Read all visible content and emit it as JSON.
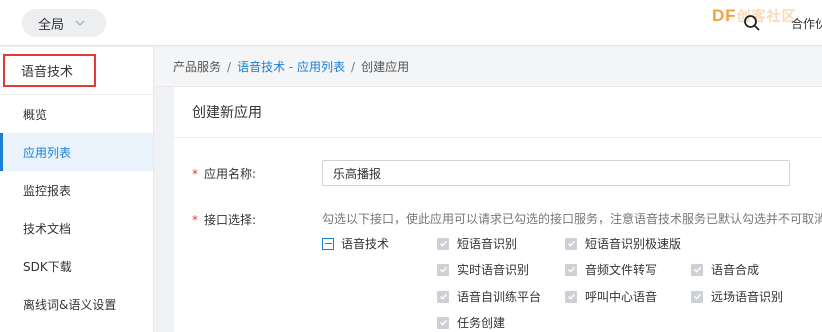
{
  "topbar": {
    "region": "全局",
    "logo_main": "DF",
    "logo_tail": "创客社区",
    "coop": "合作伙"
  },
  "sidebar": {
    "title": "语音技术",
    "items": [
      {
        "label": "概览",
        "active": false
      },
      {
        "label": "应用列表",
        "active": true
      },
      {
        "label": "监控报表",
        "active": false
      },
      {
        "label": "技术文档",
        "active": false
      },
      {
        "label": "SDK下载",
        "active": false
      },
      {
        "label": "离线词&语义设置",
        "active": false
      }
    ]
  },
  "breadcrumb": {
    "root": "产品服务",
    "sep": "/",
    "middle": "语音技术 - 应用列表",
    "current": "创建应用"
  },
  "panel": {
    "title": "创建新应用",
    "required_mark": "*",
    "name_label": "应用名称:",
    "name_value": "乐高播报",
    "api_label": "接口选择:",
    "hint": "勾选以下接口，使此应用可以请求已勾选的接口服务，注意语音技术服务已默认勾选并不可取消。",
    "group_label": "语音技术",
    "options": [
      "短语音识别",
      "短语音识别极速版",
      "实时语音识别",
      "音频文件转写",
      "语音合成",
      "语音自训练平台",
      "呼叫中心语音",
      "远场语音识别",
      "任务创建"
    ]
  },
  "colors": {
    "accent": "#1b7fd6",
    "required": "#e53935",
    "logo": "#f39a3b"
  }
}
